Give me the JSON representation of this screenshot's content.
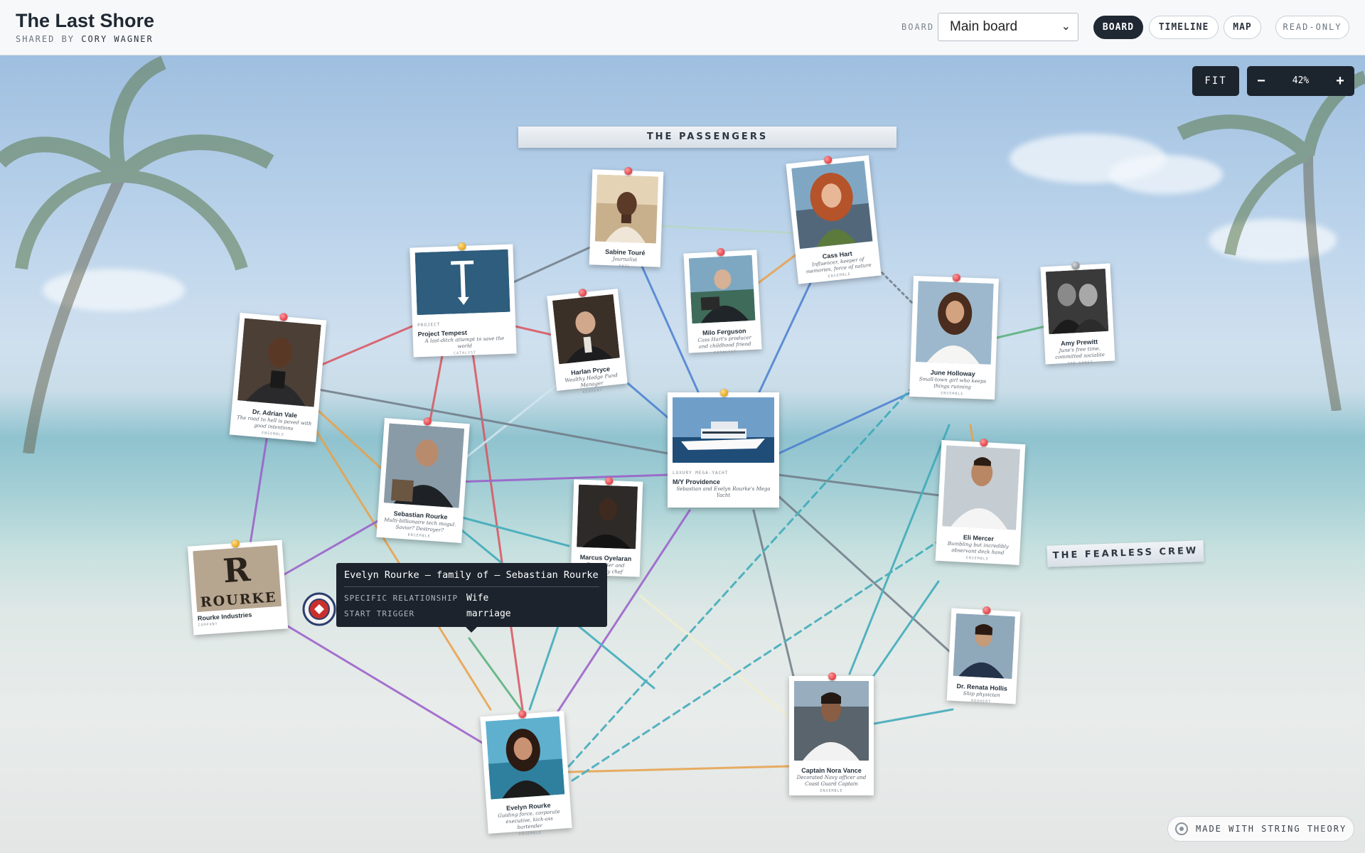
{
  "header": {
    "title": "The Last Shore",
    "shared_by_prefix": "SHARED BY",
    "shared_by_name": "CORY WAGNER",
    "board_label": "BOARD",
    "board_selected": "Main board",
    "view_tabs": [
      {
        "label": "BOARD",
        "active": true
      },
      {
        "label": "TIMELINE",
        "active": false
      },
      {
        "label": "MAP",
        "active": false
      }
    ],
    "mode_badge": "READ-ONLY"
  },
  "controls": {
    "fit_label": "FIT",
    "zoom_out": "−",
    "zoom_level": "42%",
    "zoom_in": "+"
  },
  "groups": {
    "passengers": "THE PASSENGERS",
    "crew": "THE FEARLESS CREW"
  },
  "cards": {
    "sabine": {
      "name": "Sabine Touré",
      "desc": "Journalist",
      "role": "FOIL"
    },
    "cass": {
      "name": "Cass Hart",
      "desc": "Influencer, keeper of memories, force of nature",
      "role": "ENSEMBLE"
    },
    "tempest": {
      "type": "PROJECT",
      "name": "Project Tempest",
      "desc": "A last-ditch attempt to save the world",
      "role": "CATALYST"
    },
    "harlan": {
      "name": "Harlan Pryce",
      "desc": "Wealthy Hedge Fund Manager",
      "role": "REDHERT"
    },
    "milo": {
      "name": "Milo Ferguson",
      "desc": "Cass Hart's producer and childhood friend",
      "role": "CATALYST"
    },
    "adrian": {
      "name": "Dr. Adrian Vale",
      "desc": "The road to hell is paved with good intentions",
      "role": "ENSEMBLE"
    },
    "june": {
      "name": "June Holloway",
      "desc": "Small-town girl who keeps things running",
      "role": "ENSEMBLE"
    },
    "amy": {
      "name": "Amy Prewitt",
      "desc": "June's free time, committed socialite",
      "role": "THE GHOST"
    },
    "yacht": {
      "type": "LUXURY MEGA-YACHT",
      "name": "M/Y Providence",
      "desc": "Sebastian and Evelyn Rourke's Mega Yacht"
    },
    "sebastian": {
      "name": "Sebastian Rourke",
      "desc": "Multi-billionaire tech mogul. Savior? Destroyer?",
      "role": "ENSEMBLE"
    },
    "marcus": {
      "name": "Marcus Oyelaran",
      "desc": "Sommelier and celebrity chef",
      "role": ""
    },
    "eli": {
      "name": "Eli Mercer",
      "desc": "Bumbling but incredibly observant deck hand",
      "role": "ENSEMBLE"
    },
    "rourke_ind": {
      "type": "COMPANY",
      "name": "Rourke Industries",
      "logo_text": "ROURKE",
      "logo_letter": "R"
    },
    "renata": {
      "name": "Dr. Renata Hollis",
      "desc": "Ship physician",
      "role": "REDHERT"
    },
    "nora": {
      "name": "Captain Nora Vance",
      "desc": "Decorated Navy officer and Coast Guard Captain",
      "role": "ENSEMBLE"
    },
    "evelyn": {
      "name": "Evelyn Rourke",
      "desc": "Guiding force, corporate executive, kick-ass bartender",
      "role": "ENSEMBLE"
    }
  },
  "tooltip": {
    "title": "Evelyn Rourke — family of — Sebastian Rourke",
    "rows": [
      {
        "key": "SPECIFIC RELATIONSHIP",
        "value": "Wife"
      },
      {
        "key": "START TRIGGER",
        "value": "marriage"
      }
    ]
  },
  "footer_badge": "MADE WITH STRING THEORY",
  "colors": {
    "string_red": "#d9545e",
    "string_blue": "#4a7fd0",
    "string_purple": "#9a5dc9",
    "string_orange": "#e8a14a",
    "string_teal": "#3aa9b8",
    "string_green": "#57b07a",
    "string_gray": "#707c88",
    "dark_ui": "#1c242e"
  }
}
